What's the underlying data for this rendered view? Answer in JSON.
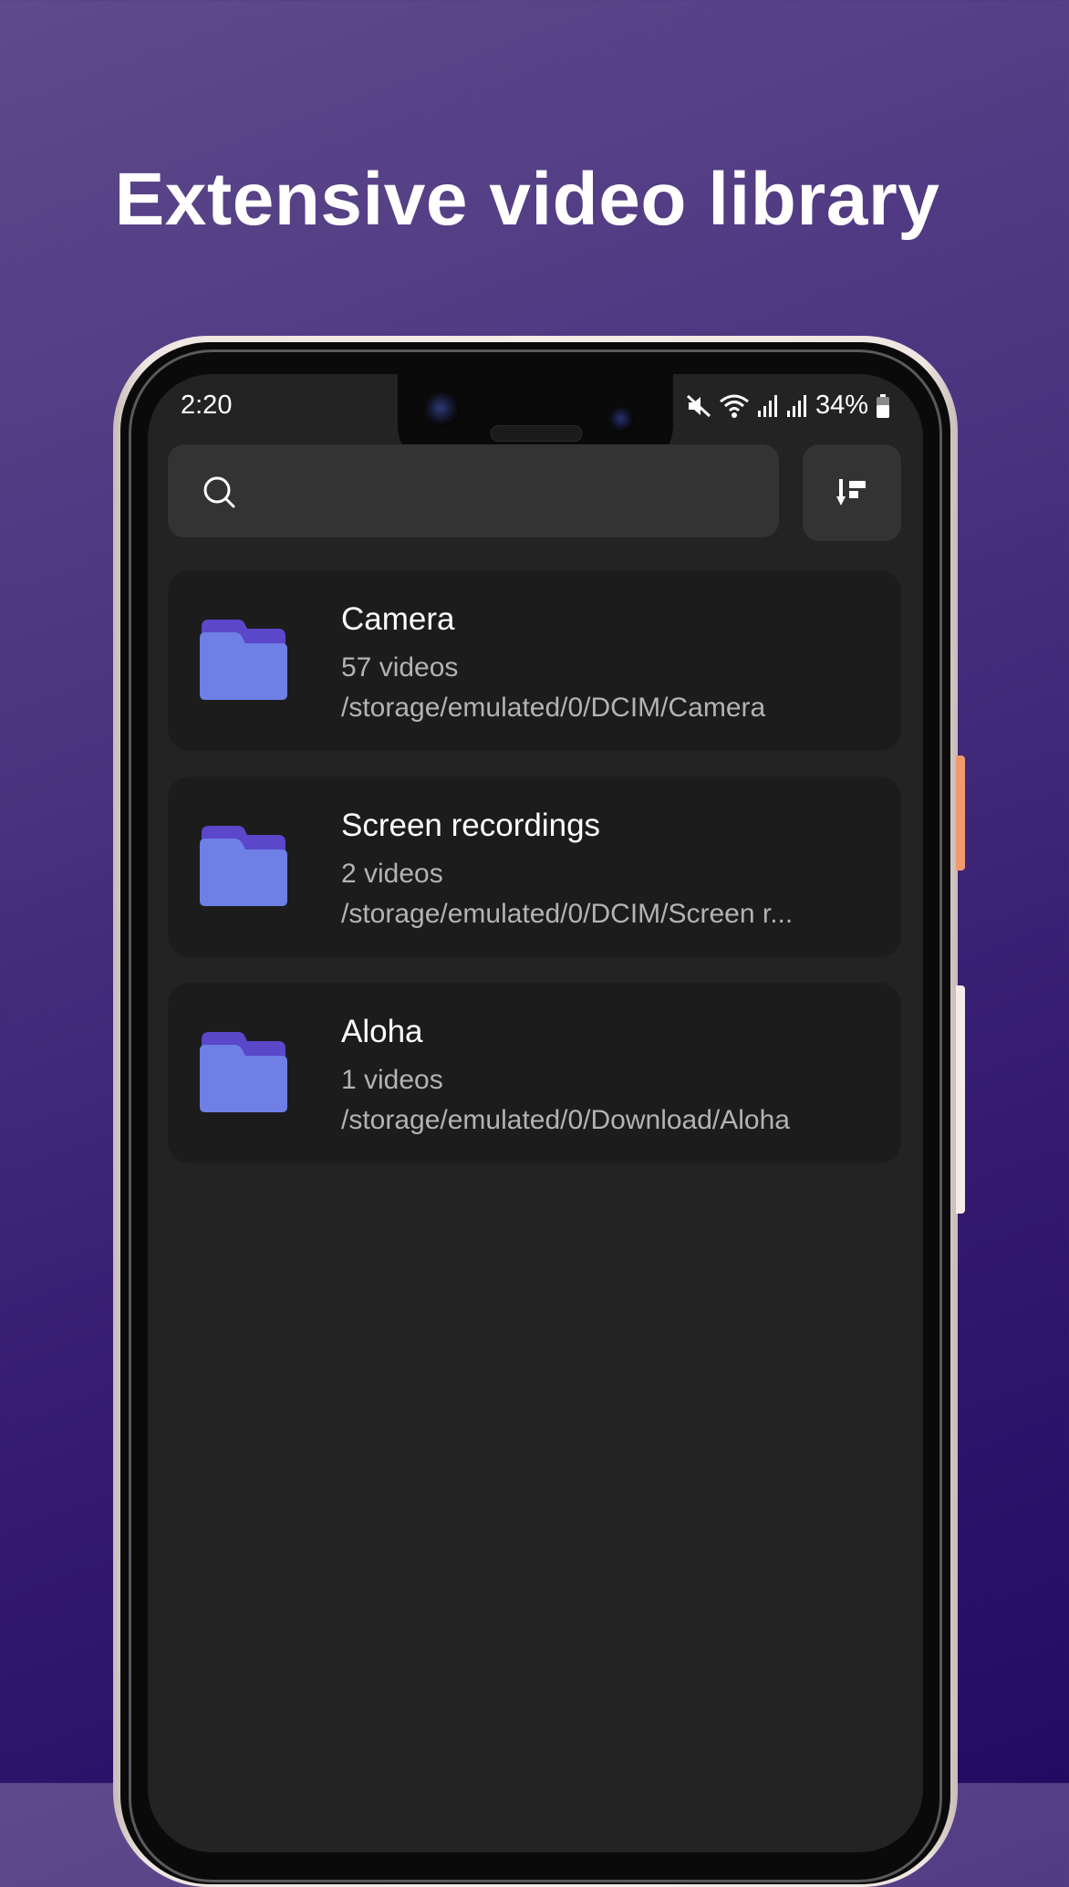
{
  "headline": "Extensive video library",
  "status_bar": {
    "time": "2:20",
    "battery_percent": "34%",
    "icons": [
      "mute-icon",
      "wifi-icon",
      "signal-icon",
      "signal-icon",
      "battery-icon"
    ]
  },
  "search": {
    "icon": "search-icon",
    "placeholder": ""
  },
  "sort_button": {
    "icon": "sort-icon"
  },
  "folders": [
    {
      "name": "Camera",
      "count": "57 videos",
      "path": "/storage/emulated/0/DCIM/Camera"
    },
    {
      "name": "Screen recordings",
      "count": "2 videos",
      "path": "/storage/emulated/0/DCIM/Screen r..."
    },
    {
      "name": "Aloha",
      "count": "1 videos",
      "path": "/storage/emulated/0/Download/Aloha"
    }
  ],
  "colors": {
    "background_top": "#5f4a8b",
    "background_bottom": "#230a63",
    "screen_bg": "#232323",
    "card_bg": "#1c1c1c",
    "folder_front": "#6e7fe6",
    "folder_back": "#5b47c9"
  }
}
